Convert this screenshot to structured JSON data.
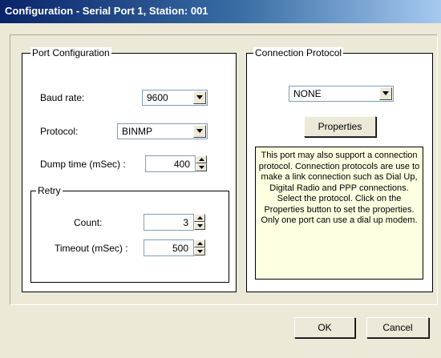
{
  "window": {
    "title": "Configuration - Serial Port 1, Station: 001"
  },
  "port_config": {
    "legend": "Port Configuration",
    "baud_rate": {
      "label": "Baud rate:",
      "value": "9600"
    },
    "protocol": {
      "label": "Protocol:",
      "value": "BINMP"
    },
    "dump_time": {
      "label": "Dump time (mSec) :",
      "value": "400"
    },
    "retry": {
      "legend": "Retry",
      "count": {
        "label": "Count:",
        "value": "3"
      },
      "timeout": {
        "label": "Timeout (mSec) :",
        "value": "500"
      }
    }
  },
  "connection": {
    "legend": "Connection Protocol",
    "protocol_value": "NONE",
    "properties_label": "Properties",
    "info_text": "This port may also support a connection protocol. Connection protocols are use to make a link connection such as Dial Up, Digital Radio and PPP connections. Select the protocol. Click on the Properties button to set the properties. Only one port can use a dial up modem."
  },
  "buttons": {
    "ok": "OK",
    "cancel": "Cancel"
  },
  "colors": {
    "title_bar_start": "#0a246a",
    "title_bar_end": "#a6caf0",
    "face": "#ece9d8",
    "info_background": "#ffffe1"
  },
  "icons": {
    "dropdown": "chevron-down-icon",
    "spin_up": "arrow-up-icon",
    "spin_down": "arrow-down-icon"
  }
}
